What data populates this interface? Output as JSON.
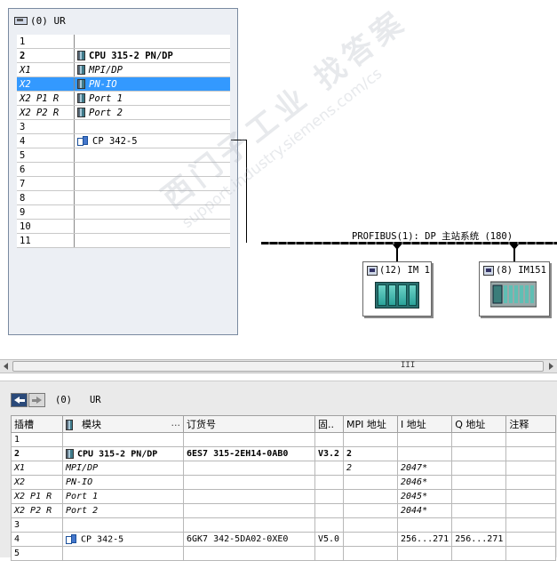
{
  "rack": {
    "title": "(0) UR",
    "rows": [
      {
        "slot": "1",
        "module": "",
        "icon": "",
        "style": ""
      },
      {
        "slot": "2",
        "module": "CPU 315-2 PN/DP",
        "icon": "module-icon",
        "style": "bold"
      },
      {
        "slot": "X1",
        "module": "MPI/DP",
        "icon": "module-icon",
        "style": "sub"
      },
      {
        "slot": "X2",
        "module": "PN-IO",
        "icon": "module-icon",
        "style": "sub sel"
      },
      {
        "slot": "X2 P1 R",
        "module": "Port 1",
        "icon": "module-icon",
        "style": "sub"
      },
      {
        "slot": "X2 P2 R",
        "module": "Port 2",
        "icon": "module-icon",
        "style": "sub"
      },
      {
        "slot": "3",
        "module": "",
        "icon": "",
        "style": ""
      },
      {
        "slot": "4",
        "module": "CP 342-5",
        "icon": "cp-icon",
        "style": ""
      },
      {
        "slot": "5",
        "module": "",
        "icon": "",
        "style": ""
      },
      {
        "slot": "6",
        "module": "",
        "icon": "",
        "style": ""
      },
      {
        "slot": "7",
        "module": "",
        "icon": "",
        "style": ""
      },
      {
        "slot": "8",
        "module": "",
        "icon": "",
        "style": ""
      },
      {
        "slot": "9",
        "module": "",
        "icon": "",
        "style": ""
      },
      {
        "slot": "10",
        "module": "",
        "icon": "",
        "style": ""
      },
      {
        "slot": "11",
        "module": "",
        "icon": "",
        "style": ""
      }
    ]
  },
  "network": {
    "bus_label": "PROFIBUS(1): DP 主站系统 (180)",
    "stations": [
      {
        "label": "(12) IM 1",
        "icon": "im1-station-icon"
      },
      {
        "label": "(8) IM151",
        "icon": "im151-station-icon"
      }
    ]
  },
  "scrollbar": {
    "grip": "III"
  },
  "detail": {
    "nav_rack": "(0)",
    "nav_ur": "UR",
    "headers": {
      "slot": "插槽",
      "module": "模块",
      "module_dots": "...",
      "order": "订货号",
      "firmware": "固..",
      "mpi": "MPI 地址",
      "i_addr": "I 地址",
      "q_addr": "Q 地址",
      "comment": "注释"
    },
    "rows": [
      {
        "slot": "1",
        "module": "",
        "icon": "",
        "order": "",
        "fw": "",
        "mpi": "",
        "i": "",
        "q": "",
        "comment": "",
        "style": ""
      },
      {
        "slot": "2",
        "module": "CPU 315-2 PN/DP",
        "icon": "module-icon",
        "order": "6ES7 315-2EH14-0AB0",
        "fw": "V3.2",
        "mpi": "2",
        "i": "",
        "q": "",
        "comment": "",
        "style": "bold"
      },
      {
        "slot": "X1",
        "module": "MPI/DP",
        "icon": "",
        "order": "",
        "fw": "",
        "mpi": "2",
        "i": "2047*",
        "q": "",
        "comment": "",
        "style": "sub"
      },
      {
        "slot": "X2",
        "module": "PN-IO",
        "icon": "",
        "order": "",
        "fw": "",
        "mpi": "",
        "i": "2046*",
        "q": "",
        "comment": "",
        "style": "sub"
      },
      {
        "slot": "X2 P1 R",
        "module": "Port 1",
        "icon": "",
        "order": "",
        "fw": "",
        "mpi": "",
        "i": "2045*",
        "q": "",
        "comment": "",
        "style": "sub"
      },
      {
        "slot": "X2 P2 R",
        "module": "Port 2",
        "icon": "",
        "order": "",
        "fw": "",
        "mpi": "",
        "i": "2044*",
        "q": "",
        "comment": "",
        "style": "sub"
      },
      {
        "slot": "3",
        "module": "",
        "icon": "",
        "order": "",
        "fw": "",
        "mpi": "",
        "i": "",
        "q": "",
        "comment": "",
        "style": ""
      },
      {
        "slot": "4",
        "module": "CP 342-5",
        "icon": "cp-icon",
        "order": "6GK7 342-5DA02-0XE0",
        "fw": "V5.0",
        "mpi": "",
        "i": "256...271",
        "q": "256...271",
        "comment": "",
        "style": ""
      },
      {
        "slot": "5",
        "module": "",
        "icon": "",
        "order": "",
        "fw": "",
        "mpi": "",
        "i": "",
        "q": "",
        "comment": "",
        "style": ""
      }
    ]
  },
  "watermark": {
    "text_cn": "西门子工业 找答案",
    "text_url": "support.industry.siemens.com/cs"
  }
}
